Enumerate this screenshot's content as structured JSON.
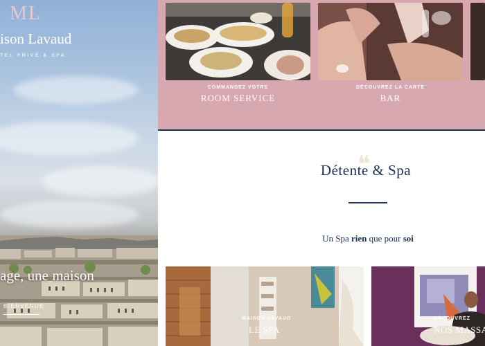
{
  "brand": {
    "monogram": "ML",
    "name": "ison Lavaud",
    "tagline": "TEL PRIVÉ & SPA"
  },
  "hero": {
    "heading": "age, une maison",
    "link_label": "BIENVENUE"
  },
  "tiles": [
    {
      "kicker": "COMMANDEZ VOTRE",
      "title": "ROOM SERVICE"
    },
    {
      "kicker": "DÉCOUVREZ LA CARTE",
      "title": "BAR"
    }
  ],
  "spa": {
    "title": "Détente & Spa",
    "subtitle_before": "Un Spa ",
    "subtitle_bold1": "rien",
    "subtitle_mid": " que pour ",
    "subtitle_bold2": "soi"
  },
  "cards": [
    {
      "kicker": "MAISON LAVAUD",
      "title": "LE SPA"
    },
    {
      "kicker": "DÉCOUVREZ",
      "title": "NOS MASSA"
    }
  ],
  "colors": {
    "navy": "#1d2f55",
    "pink": "#d8a8b0",
    "plum": "#6b2f5c"
  }
}
